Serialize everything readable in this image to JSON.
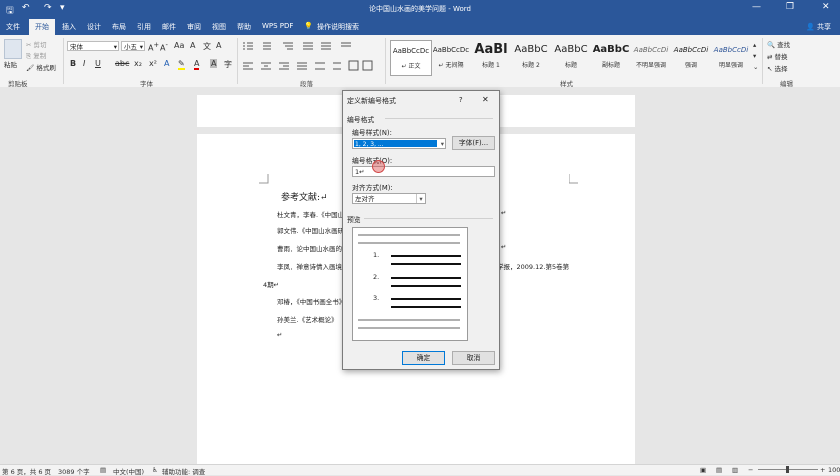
{
  "app": {
    "title": "论中国山水画的美学问题 - Word",
    "window_controls": [
      "—",
      "❐",
      "✕"
    ]
  },
  "tabs": [
    "文件",
    "开始",
    "插入",
    "设计",
    "布局",
    "引用",
    "邮件",
    "审阅",
    "视图",
    "帮助",
    "WPS PDF",
    "操作说明搜索"
  ],
  "tabs_active": "开始",
  "ribbon": {
    "clipboard": {
      "paste": "粘贴",
      "cut": "剪切",
      "copy": "复制",
      "format_painter": "格式刷",
      "label": "剪贴板"
    },
    "font": {
      "name": "宋体",
      "size": "小五",
      "label": "字体"
    },
    "paragraph": {
      "label": "段落"
    },
    "styles": {
      "label": "样式",
      "items": [
        {
          "preview": "AaBbCcDc",
          "name": "正文"
        },
        {
          "preview": "AaBbCcDc",
          "name": "无间隔"
        },
        {
          "preview": "AaBl",
          "name": "标题 1"
        },
        {
          "preview": "AaBbC",
          "name": "标题 2"
        },
        {
          "preview": "AaBbC",
          "name": "标题"
        },
        {
          "preview": "AaBbC",
          "name": "副标题"
        },
        {
          "preview": "AaBbCcDi",
          "name": "不明显强调"
        },
        {
          "preview": "AaBbCcDi",
          "name": "强调"
        },
        {
          "preview": "AaBbCcDi",
          "name": "明显强调"
        }
      ]
    },
    "editing": {
      "find": "查找",
      "replace": "替换",
      "select": "选择",
      "label": "编辑"
    },
    "share": "共享"
  },
  "document": {
    "heading": "参考文献:↵",
    "lines": [
      "杜文青，李春.《中国山",
      "郭文伟.《中国山水画研",
      "曹雨．论中国山水画的",
      "李凤．禅意诗情入画境",
      "4期↵",
      "邓椿，《中国书画全书》",
      "孙美兰.《艺术概论》",
      "↵"
    ],
    "right_fragments": [
      "↵",
      "↵",
      "学报，2009.12.第5卷第"
    ]
  },
  "status": {
    "page": "第 6 页，共 6 页",
    "words": "3089 个字",
    "language": "中文(中国)",
    "accessibility": "辅助功能: 调查",
    "zoom": "100%"
  },
  "dialog": {
    "title": "定义新编号格式",
    "help": "?",
    "close": "✕",
    "section_number_format": "编号格式",
    "number_style_label": "编号样式(N):",
    "number_style_value": "1, 2, 3, ...",
    "font_button": "字体(F)...",
    "number_format_label": "编号格式(O):",
    "number_format_value": "1↵",
    "alignment_label": "对齐方式(M):",
    "alignment_value": "左对齐",
    "preview_label": "预览",
    "preview_numbers": [
      "1.",
      "2.",
      "3."
    ],
    "ok": "确定",
    "cancel": "取消"
  },
  "colors": {
    "word_blue": "#2b579a",
    "selection": "#0078d7"
  }
}
